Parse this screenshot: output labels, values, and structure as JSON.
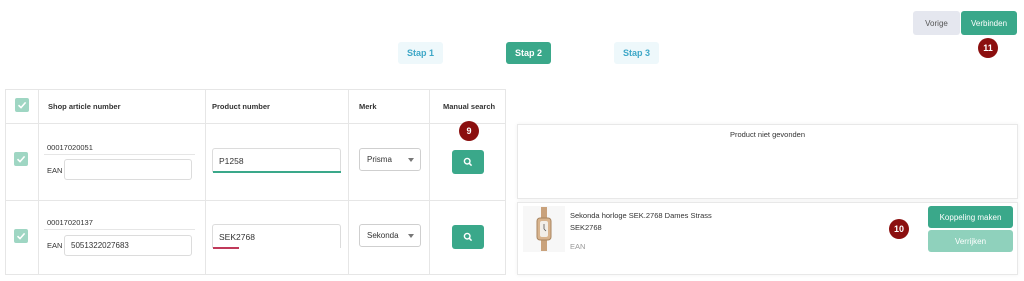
{
  "header": {
    "prev_label": "Vorige",
    "connect_label": "Verbinden"
  },
  "steps": [
    {
      "label": "Stap 1",
      "active": false
    },
    {
      "label": "Stap 2",
      "active": true
    },
    {
      "label": "Stap 3",
      "active": false
    }
  ],
  "annotations": {
    "search_badge": "9",
    "koppel_badge": "10",
    "connect_badge": "11"
  },
  "table": {
    "headers": {
      "shop_article": "Shop article number",
      "product_number": "Product number",
      "merk": "Merk",
      "manual_search": "Manual search"
    },
    "rows": [
      {
        "checked": true,
        "shop_article_number": "00017020051",
        "ean_label": "EAN",
        "ean_value": "",
        "product_number": "P1258",
        "underline_color": "#3aa88a",
        "merk": "Prisma"
      },
      {
        "checked": true,
        "shop_article_number": "00017020137",
        "ean_label": "EAN",
        "ean_value": "5051322027683",
        "product_number": "SEK2768",
        "underline_color": "#c0395a",
        "merk": "Sekonda"
      }
    ]
  },
  "results": {
    "not_found_text": "Product niet gevonden",
    "product_title": "Sekonda horloge SEK.2768 Dames Strass",
    "product_code": "SEK2768",
    "product_ean_label": "EAN",
    "koppel_label": "Koppeling maken",
    "verrijk_label": "Verrijken"
  },
  "icons": {
    "check": "check-icon",
    "search": "search-icon",
    "caret": "chevron-down-icon",
    "watch": "watch-image"
  },
  "colors": {
    "accent": "#3aa88a",
    "accent_light": "#8fd1bc",
    "step_inactive_text": "#3ea7c7",
    "badge": "#8b0f0f"
  }
}
